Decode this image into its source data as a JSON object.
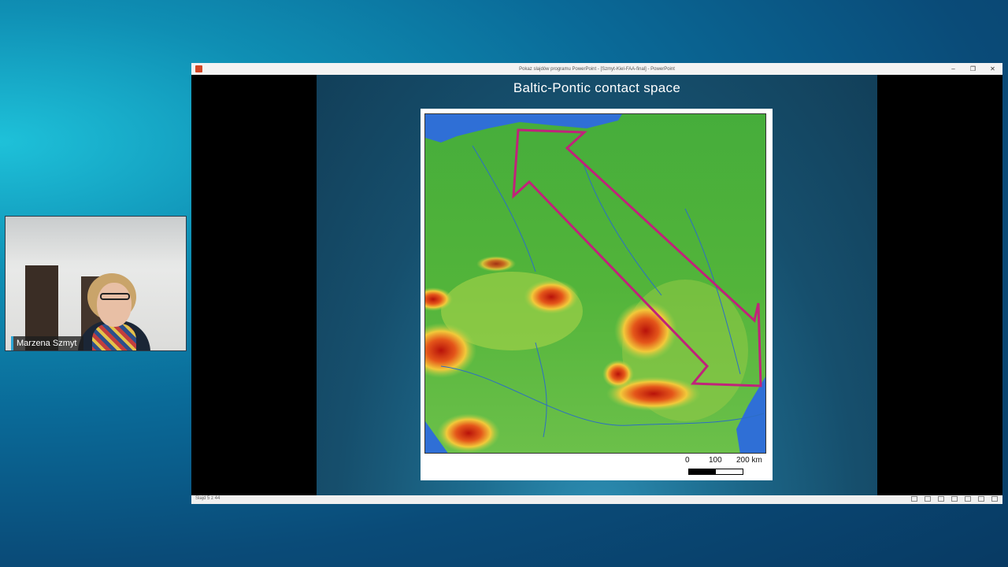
{
  "participant": {
    "name": "Marzena Szmyt"
  },
  "window": {
    "title": "Pokaz slajdów programu PowerPoint - [Szmyt-Kiel-FAA-final] - PowerPoint",
    "minimize_icon": "minimize-icon",
    "restore_icon": "restore-icon",
    "close_icon": "close-icon"
  },
  "slide": {
    "title": "Baltic-Pontic contact space",
    "scale": {
      "label_0": "0",
      "label_100": "100",
      "label_200": "200 km"
    }
  },
  "status": {
    "slide_counter": "Slajd 5 z 44"
  },
  "colors": {
    "arrow": "#c0237a",
    "sea": "#2f6fd6",
    "lowland": "#3fae3a",
    "mountain_high": "#c0180a"
  }
}
